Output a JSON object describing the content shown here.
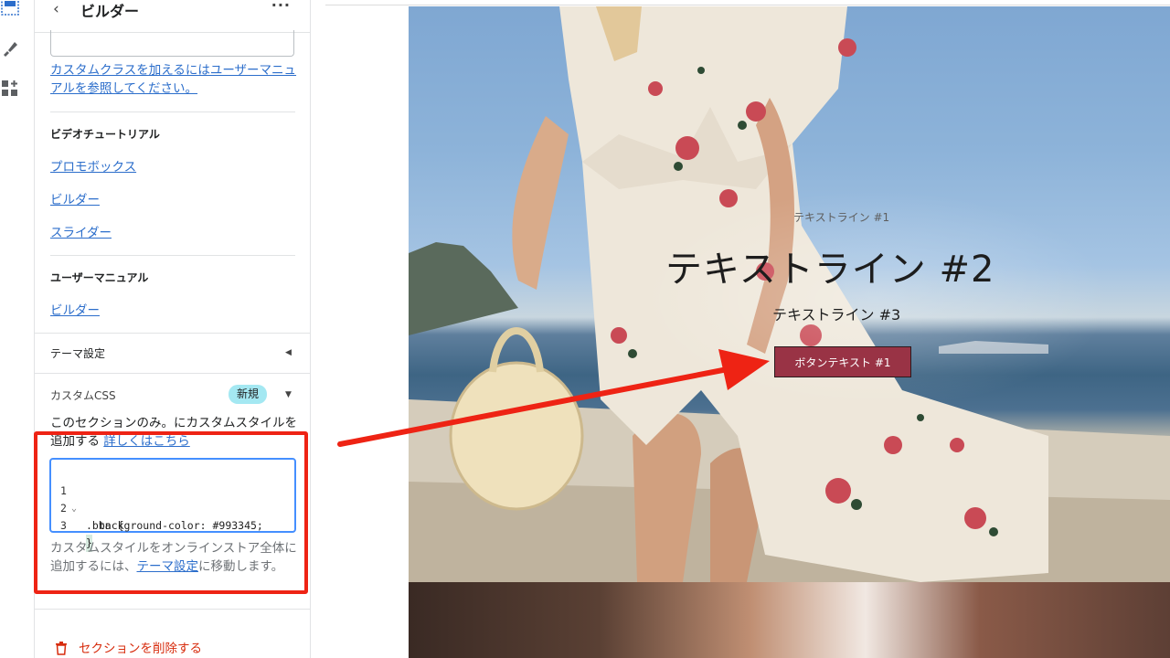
{
  "panel": {
    "title": "ビルダー",
    "back_glyph": "‹",
    "more_glyph": "···",
    "custom_class_help": "カスタムクラスを加えるにはユーザーマニュアルを参照してください。",
    "video_tutorial": {
      "heading": "ビデオチュートリアル",
      "links": [
        "プロモボックス",
        "ビルダー",
        "スライダー"
      ]
    },
    "user_manual": {
      "heading": "ユーザーマニュアル",
      "links": [
        "ビルダー"
      ]
    },
    "theme_settings": "テーマ設定",
    "custom_css": {
      "label": "カスタムCSS",
      "badge": "新規",
      "desc_prefix": "このセクションのみ。にカスタムスタイルを追加する",
      "desc_link": "詳しくはこちら",
      "code_lines": [
        {
          "num": "1",
          "text": ".btn {"
        },
        {
          "num": "2",
          "text": "  background-color: #993345;"
        },
        {
          "num": "3",
          "text": "}"
        }
      ],
      "footer_prefix": "カスタムスタイルをオンラインストア全体に追加するには、",
      "footer_link": "テーマ設定",
      "footer_suffix": "に移動します。"
    },
    "delete_section": "セクションを削除する"
  },
  "preview": {
    "line1": "テキストライン #1",
    "line2": "テキストライン #2",
    "line3": "テキストライン #3",
    "button_label": "ボタンテキスト #1",
    "button_color": "#993345"
  },
  "icons": [
    "sections-icon",
    "theme-brush-icon",
    "apps-icon",
    "trash-icon",
    "caret-left-icon",
    "caret-down-icon"
  ],
  "colors": {
    "link": "#2c6ecb",
    "highlight_frame": "#ee2314",
    "badge": "#a4e8f2",
    "delete": "#d72c0d"
  }
}
